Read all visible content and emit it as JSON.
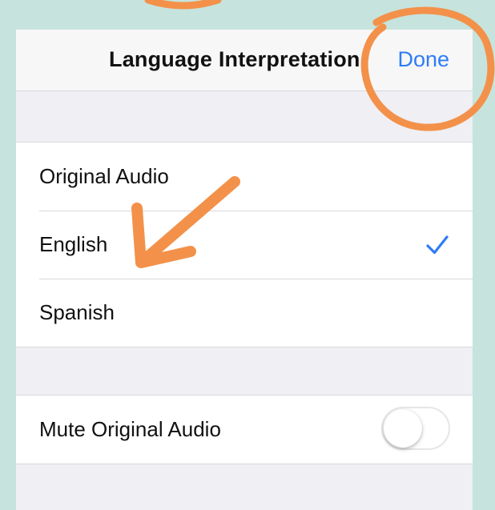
{
  "navbar": {
    "title": "Language Interpretation",
    "done_label": "Done"
  },
  "language_options": [
    {
      "label": "Original Audio",
      "selected": false
    },
    {
      "label": "English",
      "selected": true
    },
    {
      "label": "Spanish",
      "selected": false
    }
  ],
  "mute_row": {
    "label": "Mute Original Audio",
    "toggle_on": false
  },
  "colors": {
    "accent": "#2f7cf6",
    "annotation": "#f3914a",
    "background": "#c6e4dd"
  },
  "icons": {
    "selected_mark": "checkmark-icon"
  }
}
